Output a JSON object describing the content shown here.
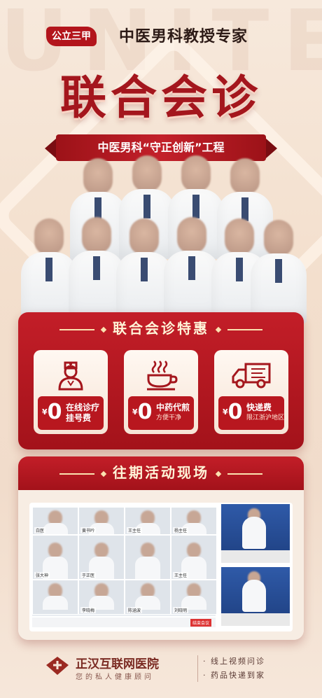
{
  "header": {
    "badge": "公立三甲",
    "subtitle": "中医男科教授专家",
    "title": "联合会诊",
    "ribbon": "中医男科“守正创新”工程"
  },
  "offers": {
    "heading": "联合会诊特惠",
    "items": [
      {
        "icon": "doctor-icon",
        "currency": "¥",
        "price": "0",
        "line1": "在线诊疗",
        "line2": "挂号费"
      },
      {
        "icon": "medicine-cup-icon",
        "currency": "¥",
        "price": "0",
        "line1": "中药代煎",
        "line2": "方便干净"
      },
      {
        "icon": "delivery-truck-icon",
        "currency": "¥",
        "price": "0",
        "line1": "快递费",
        "line2": "限江浙沪地区"
      }
    ]
  },
  "past_events": {
    "heading": "往期活动现场",
    "video_names": [
      "白医",
      "黄书吟",
      "王主任",
      "杨主任",
      "张大神",
      "于正医",
      "王主任",
      "李晓梅",
      "陈涵波",
      "刘晓明"
    ],
    "end_label": "结束会议"
  },
  "footer": {
    "hospital": "正汉互联网医院",
    "slogan": "您的私人健康顾问",
    "features": [
      "· 线上视频问诊",
      "· 药品快递到家"
    ]
  },
  "colors": {
    "brand_red": "#a4161d",
    "cream": "#f6e7da"
  }
}
